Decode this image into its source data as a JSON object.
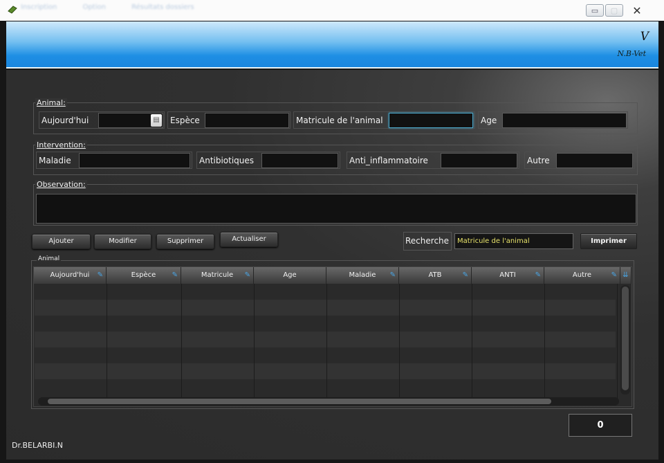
{
  "menu": [
    "Inscription",
    "Option",
    "Résultats dossiers"
  ],
  "window_buttons": {
    "minimize": "▭",
    "maximize": "▢",
    "close": "✕"
  },
  "banner": {
    "mark": "V",
    "brand": "N.B-Vet"
  },
  "animal_group": {
    "title": "Animal:",
    "date_label": "Aujourd'hui",
    "espece_label": "Espèce",
    "matricule_label": "Matricule de l'animal",
    "age_label": "Age"
  },
  "intervention_group": {
    "title": "Intervention:",
    "maladie_label": "Maladie",
    "antibiotiques_label": "Antibiotiques",
    "anti_inflammatoire_label": "Anti_inflammatoire",
    "autre_label": "Autre"
  },
  "observation_group": {
    "title": "Observation:"
  },
  "actions": {
    "ajouter": "Ajouter",
    "modifier": "Modifier",
    "supprimer": "Supprimer",
    "actualiser": "Actualiser"
  },
  "search": {
    "label": "Recherche",
    "value": "Matricule de l'animal"
  },
  "print_label": "Imprimer",
  "grid": {
    "title": "Animal",
    "columns": [
      "Aujourd'hui",
      "Espèce",
      "Matricule",
      "Age",
      "Maladie",
      "ATB",
      "ANTI",
      "Autre"
    ]
  },
  "count": "0",
  "footer": "Dr.BELARBI.N"
}
